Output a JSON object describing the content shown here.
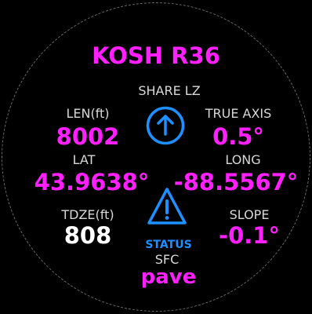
{
  "colors": {
    "accent": "#ff1fff",
    "label": "#d8d8d8",
    "value_white": "#ffffff",
    "icon_blue": "#1e90ff",
    "background": "#000000"
  },
  "airport": {
    "title": "KOSH R36"
  },
  "share": {
    "label": "SHARE LZ",
    "icon": "arrow-up-circle-icon"
  },
  "runway": {
    "length_label": "LEN(ft)",
    "length_value": "8002",
    "true_axis_label": "TRUE AXIS",
    "true_axis_value": "0.5°"
  },
  "coordinates": {
    "lat_label": "LAT",
    "lat_value": "43.9638°",
    "long_label": "LONG",
    "long_value": "-88.5567°"
  },
  "elevation": {
    "tdze_label": "TDZE(ft)",
    "tdze_value": "808",
    "slope_label": "SLOPE",
    "slope_value": "-0.1°"
  },
  "status": {
    "icon": "warning-triangle-icon",
    "label": "STATUS"
  },
  "surface": {
    "label": "SFC",
    "value": "pave"
  }
}
